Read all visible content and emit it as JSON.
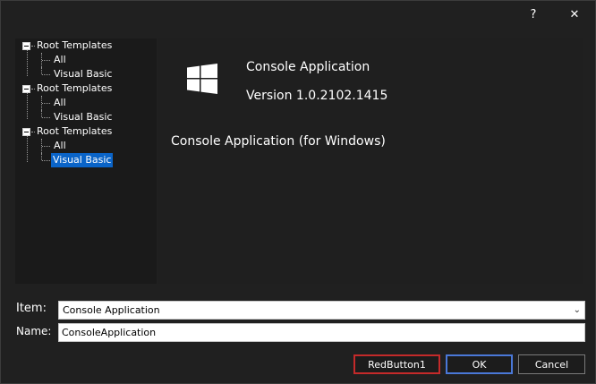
{
  "titlebar": {
    "help_label": "?",
    "close_label": "✕"
  },
  "tree": {
    "nodes": [
      {
        "label": "Root Templates",
        "children": [
          "All",
          "Visual Basic"
        ]
      },
      {
        "label": "Root Templates",
        "children": [
          "All",
          "Visual Basic"
        ]
      },
      {
        "label": "Root Templates",
        "children": [
          "All",
          "Visual Basic"
        ]
      }
    ],
    "selected": "Root Templates / Visual Basic (third group)"
  },
  "detail": {
    "icon": "windows-logo-icon",
    "name": "Console Application",
    "version": "Version 1.0.2102.1415",
    "description": "Console Application (for Windows)"
  },
  "form": {
    "item_label": "Item:",
    "item_value": "Console Application",
    "name_label": "Name:",
    "name_value": "ConsoleApplication"
  },
  "buttons": {
    "red_label": "RedButton1",
    "ok_label": "OK",
    "cancel_label": "Cancel"
  },
  "colors": {
    "background": "#202020",
    "selection": "#0a64c8",
    "red_border": "#c42a2a",
    "ok_border": "#4a78d8"
  }
}
